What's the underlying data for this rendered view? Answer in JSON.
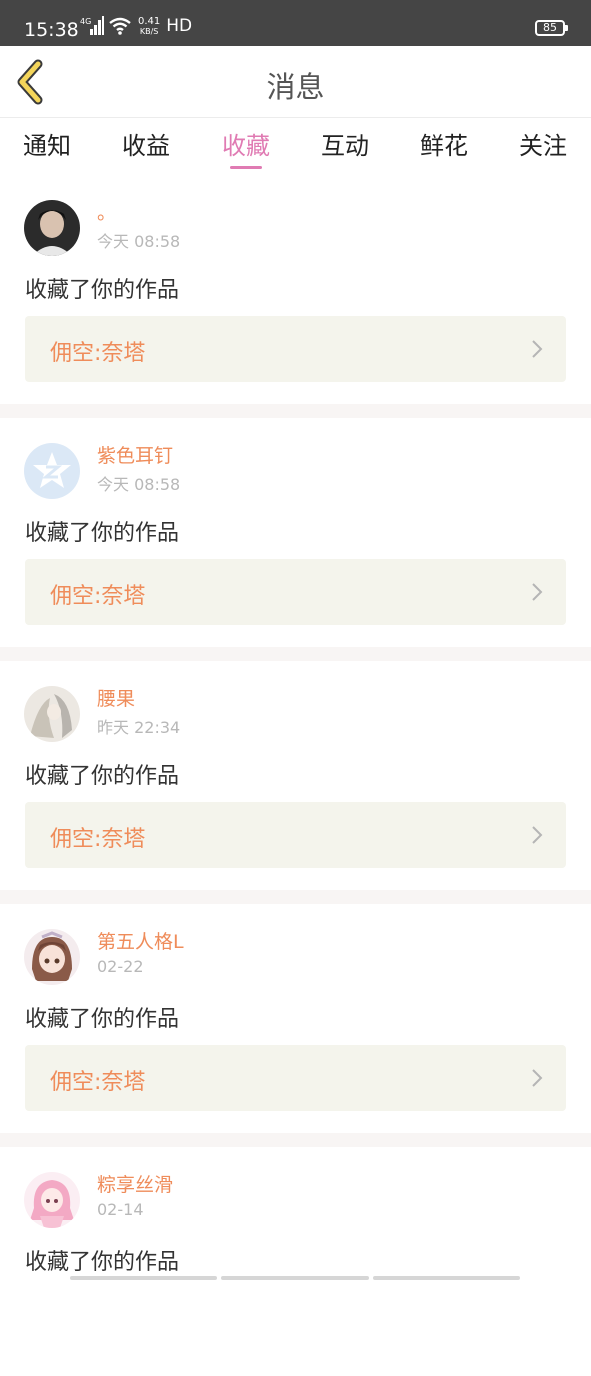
{
  "status": {
    "time": "15:38",
    "network": "4G",
    "speed_value": "0.41",
    "speed_unit": "KB/S",
    "hd": "HD",
    "battery": "85"
  },
  "header": {
    "title": "消息",
    "back_icon": "chevron-left-icon"
  },
  "tabs": [
    {
      "label": "通知",
      "active": false
    },
    {
      "label": "收益",
      "active": false
    },
    {
      "label": "收藏",
      "active": true
    },
    {
      "label": "互动",
      "active": false
    },
    {
      "label": "鲜花",
      "active": false
    },
    {
      "label": "关注",
      "active": false
    }
  ],
  "messages": [
    {
      "name": "。",
      "time": "今天 08:58",
      "action": "收藏了你的作品",
      "work": "佣空:奈塔"
    },
    {
      "name": "紫色耳钉",
      "time": "今天 08:58",
      "action": "收藏了你的作品",
      "work": "佣空:奈塔"
    },
    {
      "name": "腰果",
      "time": "昨天 22:34",
      "action": "收藏了你的作品",
      "work": "佣空:奈塔"
    },
    {
      "name": "第五人格L",
      "time": "02-22",
      "action": "收藏了你的作品",
      "work": "佣空:奈塔"
    },
    {
      "name": "粽享丝滑",
      "time": "02-14",
      "action": "收藏了你的作品",
      "work": ""
    }
  ],
  "colors": {
    "accent": "#e07bb3",
    "name": "#ef8c5a",
    "status_bar": "#454545",
    "card_bg": "#f4f4ec"
  }
}
